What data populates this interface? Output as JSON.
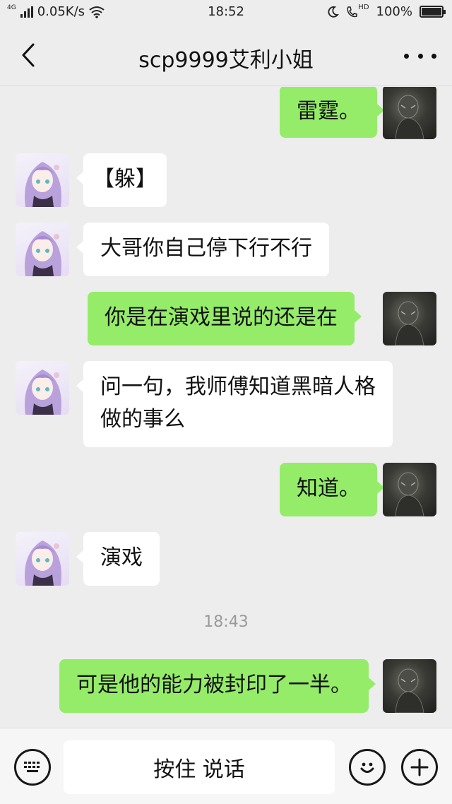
{
  "status_bar": {
    "network_tag": "4G",
    "speed": "0.05K/s",
    "time": "18:52",
    "hd_tag": "HD",
    "battery": "100%",
    "battery_level": 1.0
  },
  "nav": {
    "title": "scp9999艾利小姐"
  },
  "messages": [
    {
      "side": "out",
      "text": "雷霆。"
    },
    {
      "side": "in",
      "text": "【躲】"
    },
    {
      "side": "in",
      "text": "大哥你自己停下行不行"
    },
    {
      "side": "out",
      "text": "你是在演戏里说的还是在"
    },
    {
      "side": "in",
      "text": "问一句，我师傅知道黑暗人格做的事么"
    },
    {
      "side": "out",
      "text": "知道。"
    },
    {
      "side": "in",
      "text": "演戏"
    },
    {
      "side": "out",
      "text": "可是他的能力被封印了一半。"
    }
  ],
  "timestamp": "18:43",
  "input": {
    "hold_to_talk_label": "按住 说话"
  },
  "colors": {
    "background": "#ededed",
    "bubble_out": "#95ec69",
    "bubble_in": "#ffffff"
  }
}
